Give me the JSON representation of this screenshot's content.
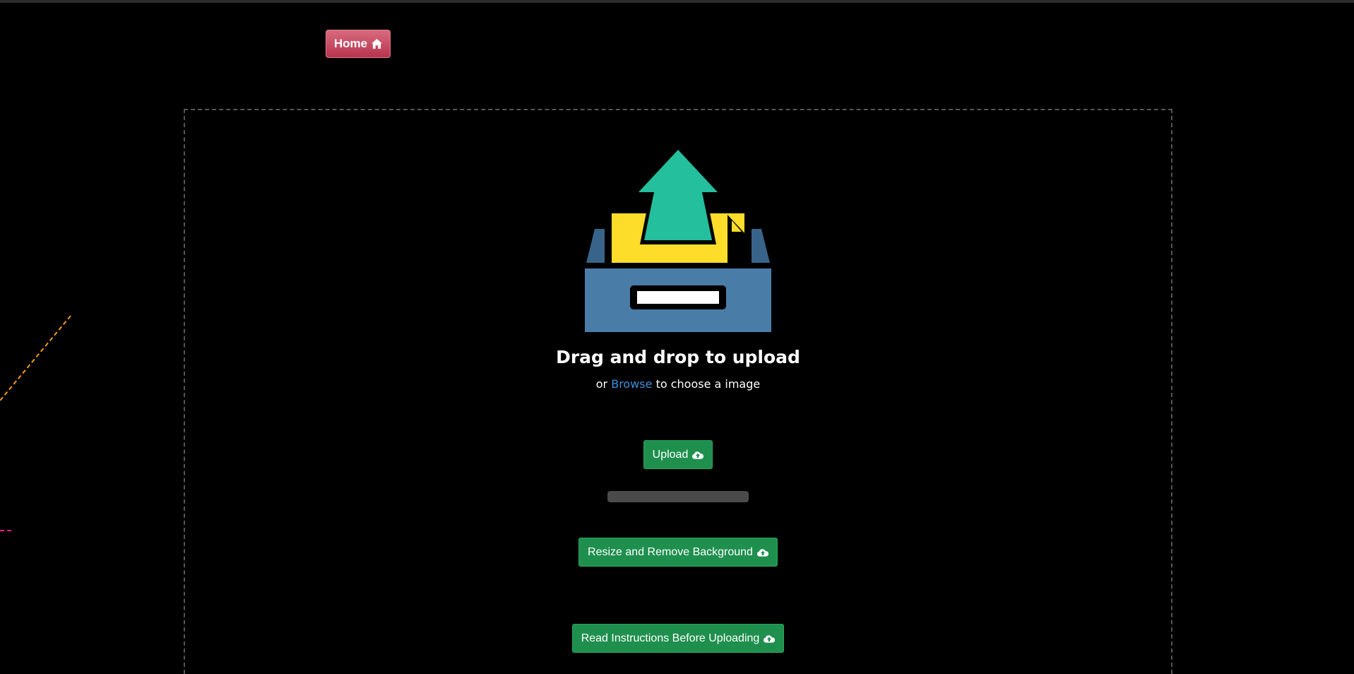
{
  "nav": {
    "home_label": "Home"
  },
  "dropzone": {
    "title": "Drag and drop to upload",
    "subtitle_prefix": "or",
    "browse_label": "Browse",
    "subtitle_suffix": "to choose a image"
  },
  "actions": {
    "upload_label": "Upload",
    "resize_label": "Resize and Remove Background",
    "instructions_label": "Read Instructions Before Uploading"
  },
  "progress": {
    "value_percent": 0
  },
  "icons": {
    "home": "home-icon",
    "cloud_upload": "cloud-upload-icon",
    "illustration": "upload-tray-illustration"
  },
  "colors": {
    "background": "#000000",
    "home_button": "#c84a62",
    "action_button": "#1f8f4e",
    "browse_link": "#3d8fdc",
    "arrow": "#24bf9c",
    "paper": "#fddc2a",
    "tray": "#4a7ca8"
  }
}
